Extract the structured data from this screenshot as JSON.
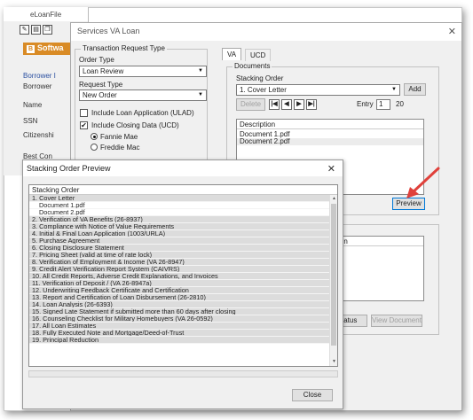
{
  "app": {
    "title": "eLoanFile",
    "brand": "Softwa",
    "labels": [
      "Borrower I",
      "Borrower",
      "Name",
      "SSN",
      "Citizenshi",
      "Best Con"
    ]
  },
  "services_dialog": {
    "title": "Services VA Loan",
    "transaction_group": {
      "title": "Transaction Request Type",
      "order_type_label": "Order Type",
      "order_type_value": "Loan Review",
      "request_type_label": "Request Type",
      "request_type_value": "New Order",
      "include_loan_app_label": "Include Loan Application (ULAD)",
      "include_closing_label": "Include Closing Data (UCD)",
      "fannie_label": "Fannie Mae",
      "freddie_label": "Freddie Mac"
    },
    "tabs": [
      "VA",
      "UCD"
    ],
    "documents_group": {
      "title": "Documents",
      "stacking_order_label": "Stacking Order",
      "stacking_order_value": "1. Cover Letter",
      "add_label": "Add",
      "delete_label": "Delete",
      "entry_label": "Entry",
      "entry_value": "1",
      "entry_total": "20",
      "description_header": "Description",
      "documents": [
        "Document 1.pdf",
        "Document 2.pdf"
      ],
      "preview_label": "Preview"
    },
    "lower_group": {
      "description_header": "ription",
      "status_label": "Status",
      "view_document_label": "View Document"
    }
  },
  "preview_dialog": {
    "title": "Stacking Order Preview",
    "header": "Stacking Order",
    "rows": [
      {
        "text": "1. Cover Letter",
        "sub": false,
        "white": false
      },
      {
        "text": "Document 1.pdf",
        "sub": true,
        "white": true
      },
      {
        "text": "Document 2.pdf",
        "sub": true,
        "white": true
      },
      {
        "text": "2. Verification of VA Benefits (26-8937)",
        "sub": false,
        "white": false
      },
      {
        "text": "3. Compliance with Notice of Value Requirements",
        "sub": false,
        "white": false
      },
      {
        "text": "4. Initial & Final Loan Application (1003/URLA)",
        "sub": false,
        "white": false
      },
      {
        "text": "5. Purchase Agreement",
        "sub": false,
        "white": false
      },
      {
        "text": "6. Closing Disclosure Statement",
        "sub": false,
        "white": false
      },
      {
        "text": "7. Pricing Sheet (valid at time of rate lock)",
        "sub": false,
        "white": false
      },
      {
        "text": "8. Verification of Employment & Income (VA 26-8947)",
        "sub": false,
        "white": false
      },
      {
        "text": "9. Credit Alert Verification Report System (CAIVRS)",
        "sub": false,
        "white": false
      },
      {
        "text": "10. All Credit Reports, Adverse Credit Explanations, and Invoices",
        "sub": false,
        "white": false
      },
      {
        "text": "11. Verification of Deposit / (VA 26-8947a)",
        "sub": false,
        "white": false
      },
      {
        "text": "12. Underwriting Feedback Certificate and Certification",
        "sub": false,
        "white": false
      },
      {
        "text": "13. Report and Certification of Loan Disbursement (26-2810)",
        "sub": false,
        "white": false
      },
      {
        "text": "14. Loan Analysis (26-6393)",
        "sub": false,
        "white": false
      },
      {
        "text": "15. Signed Late Statement if submitted more than 60 days after closing",
        "sub": false,
        "white": false
      },
      {
        "text": "16. Counseling Checklist for Military Homebuyers (VA 26-0592)",
        "sub": false,
        "white": false
      },
      {
        "text": "17. All Loan Estimates",
        "sub": false,
        "white": false
      },
      {
        "text": "18. Fully Executed Note and Mortgage/Deed-of-Trust",
        "sub": false,
        "white": false
      },
      {
        "text": "19. Principal Reduction",
        "sub": false,
        "white": false
      }
    ],
    "close_label": "Close"
  },
  "colors": {
    "brand": "#d98b26",
    "arrow": "#e0413b",
    "selection": "#dcdcdc"
  }
}
